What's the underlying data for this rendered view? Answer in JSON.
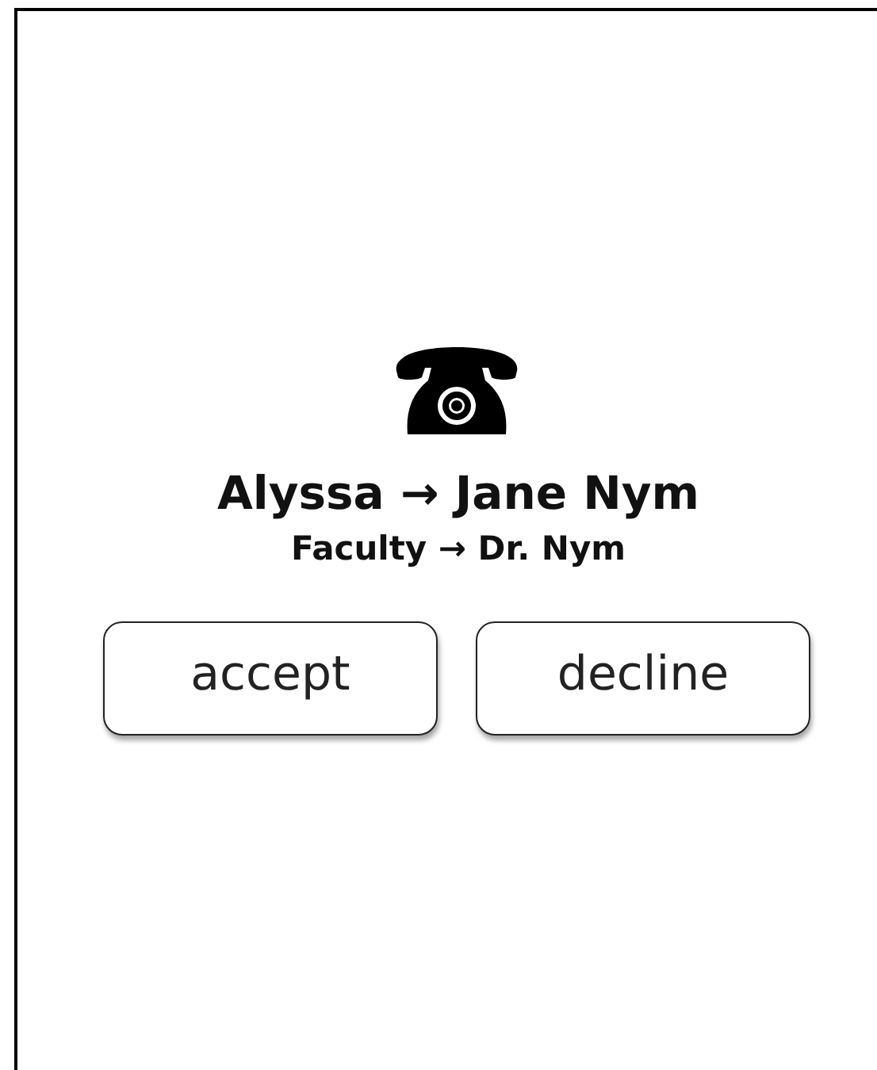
{
  "call": {
    "title": "Alyssa → Jane Nym",
    "subtitle": "Faculty → Dr. Nym"
  },
  "buttons": [
    {
      "label": "accept"
    },
    {
      "label": "decline"
    }
  ]
}
